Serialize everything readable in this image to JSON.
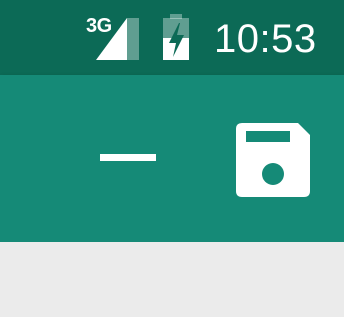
{
  "status_bar": {
    "network_type": "3G",
    "signal_icon": "cellular-signal-icon",
    "battery_icon": "battery-charging-icon",
    "time": "10:53",
    "background_color": "#0c6a56"
  },
  "app_bar": {
    "background_color": "#158a77",
    "actions": [
      {
        "name": "minimize",
        "icon": "minimize-icon"
      },
      {
        "name": "save",
        "icon": "floppy-disk-save-icon"
      }
    ]
  },
  "content": {
    "background_color": "#ebebeb"
  }
}
